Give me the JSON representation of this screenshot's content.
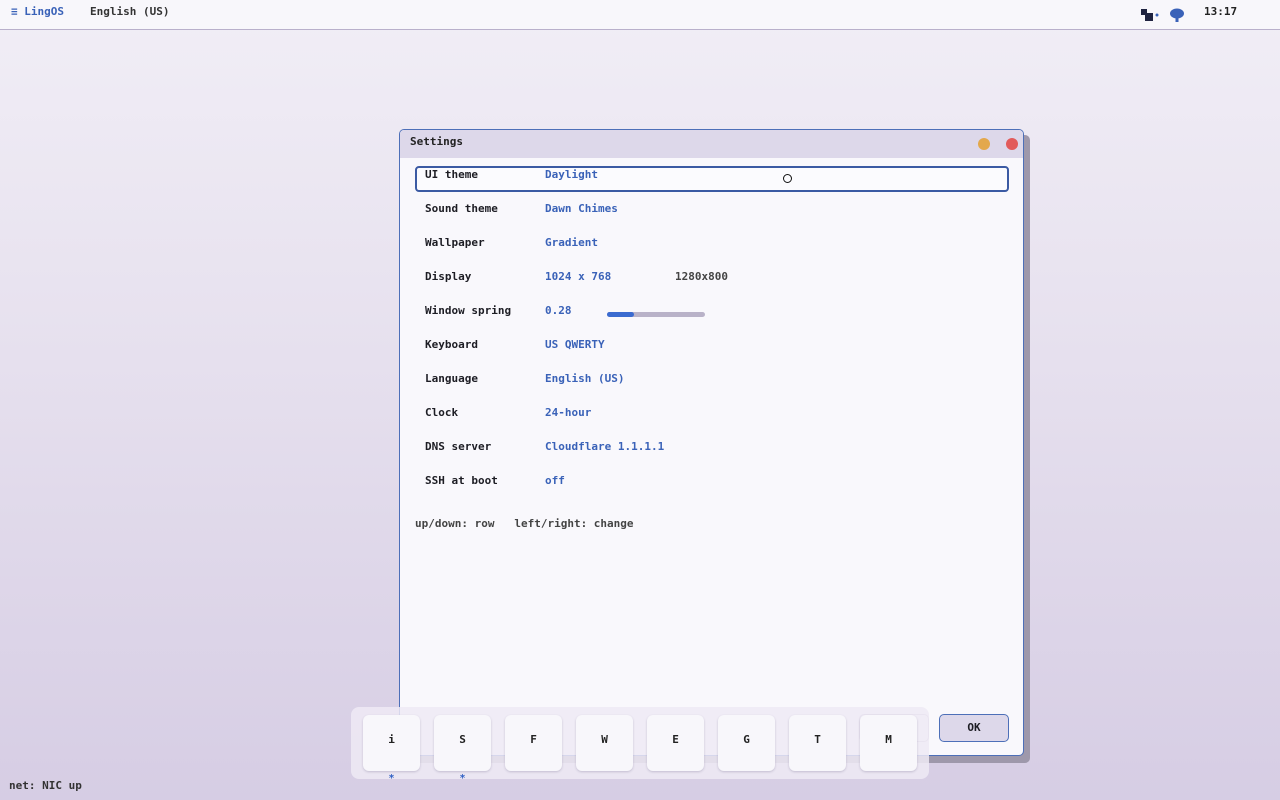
{
  "topbar": {
    "menu": "≡ LingOS",
    "language": "English (US)",
    "tray_apps_icon": "apps-tray-icon",
    "tray_chat_icon": "chat-bubble-icon",
    "clock": "13:17"
  },
  "window": {
    "title": "Settings",
    "rows": [
      {
        "label": "UI theme",
        "value": "Daylight"
      },
      {
        "label": "Sound theme",
        "value": "Dawn Chimes"
      },
      {
        "label": "Wallpaper",
        "value": "Gradient"
      },
      {
        "label": "Display",
        "value": "1024 x 768",
        "extra": "1280x800"
      },
      {
        "label": "Window spring",
        "value": "0.28",
        "slider_fraction": 0.28
      },
      {
        "label": "Keyboard",
        "value": "US QWERTY"
      },
      {
        "label": "Language",
        "value": "English (US)"
      },
      {
        "label": "Clock",
        "value": "24-hour"
      },
      {
        "label": "DNS server",
        "value": "Cloudflare 1.1.1.1"
      },
      {
        "label": "SSH at boot",
        "value": "off"
      }
    ],
    "hint": "up/down: row   left/right: change",
    "ok_label": "OK"
  },
  "dock": {
    "items": [
      "i",
      "S",
      "F",
      "W",
      "E",
      "G",
      "T",
      "M"
    ],
    "running": [
      true,
      true,
      false,
      false,
      false,
      false,
      false,
      false
    ],
    "running_marker": "*"
  },
  "status": "net: NIC up",
  "colors": {
    "accent": "#3a62b8",
    "window_border": "#4d6fb8",
    "close": "#e25b5b",
    "minimize": "#e3a84c"
  }
}
